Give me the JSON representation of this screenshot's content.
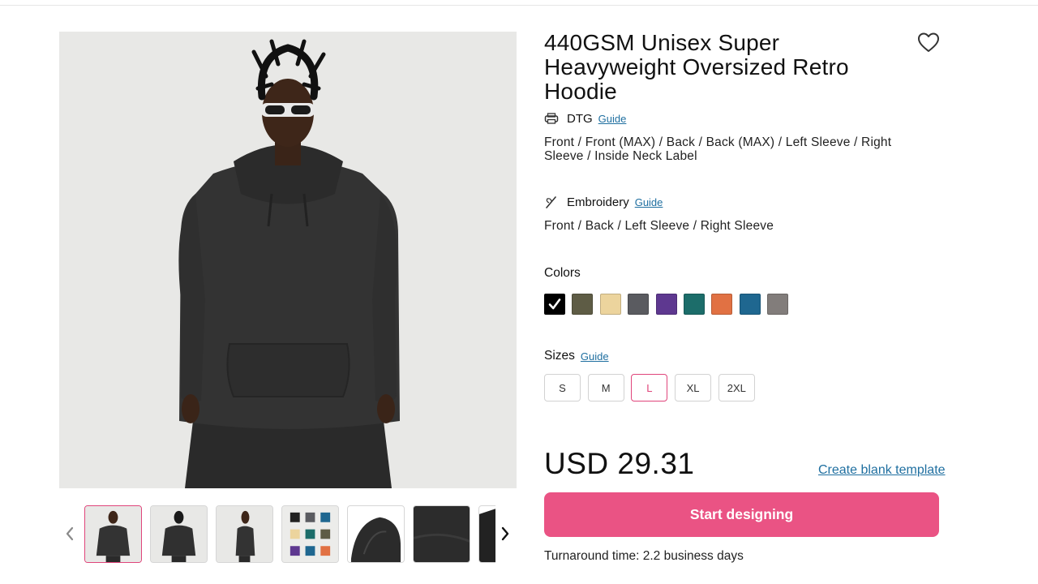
{
  "product": {
    "title": "440GSM Unisex Super Heavyweight Oversized Retro Hoodie",
    "favorite_icon": "heart-outline-icon"
  },
  "gallery": {
    "main_image": "hoodie-front-model",
    "prev_icon": "chevron-left-icon",
    "next_icon": "chevron-right-icon",
    "thumbnails": [
      {
        "name": "front-model",
        "active": true
      },
      {
        "name": "back-model",
        "active": false
      },
      {
        "name": "side-model",
        "active": false
      },
      {
        "name": "color-grid",
        "active": false
      },
      {
        "name": "hood-detail",
        "active": false
      },
      {
        "name": "fabric-detail",
        "active": false
      },
      {
        "name": "more",
        "active": false
      }
    ]
  },
  "methods": [
    {
      "name": "DTG",
      "icon": "printer-icon",
      "guide_label": "Guide",
      "placements": "Front / Front (MAX) / Back / Back (MAX) / Left Sleeve / Right Sleeve / Inside Neck Label"
    },
    {
      "name": "Embroidery",
      "icon": "needle-icon",
      "guide_label": "Guide",
      "placements": "Front / Back / Left Sleeve / Right Sleeve"
    }
  ],
  "colors": {
    "label": "Colors",
    "swatches": [
      {
        "hex": "#000000",
        "selected": true
      },
      {
        "hex": "#5e5c45",
        "selected": false
      },
      {
        "hex": "#ecd49d",
        "selected": false
      },
      {
        "hex": "#5a5b60",
        "selected": false
      },
      {
        "hex": "#5e3890",
        "selected": false
      },
      {
        "hex": "#1c6d6a",
        "selected": false
      },
      {
        "hex": "#e17143",
        "selected": false
      },
      {
        "hex": "#1f6790",
        "selected": false
      },
      {
        "hex": "#827d7b",
        "selected": false
      }
    ]
  },
  "sizes": {
    "label": "Sizes",
    "guide_label": "Guide",
    "options": [
      "S",
      "M",
      "L",
      "XL",
      "2XL"
    ],
    "selected": "L"
  },
  "price": "USD 29.31",
  "create_blank_label": "Create blank template",
  "start_button_label": "Start designing",
  "turnaround": "Turnaround time: 2.2 business days",
  "accent_color": "#ea5384",
  "link_color": "#1f6fa0"
}
